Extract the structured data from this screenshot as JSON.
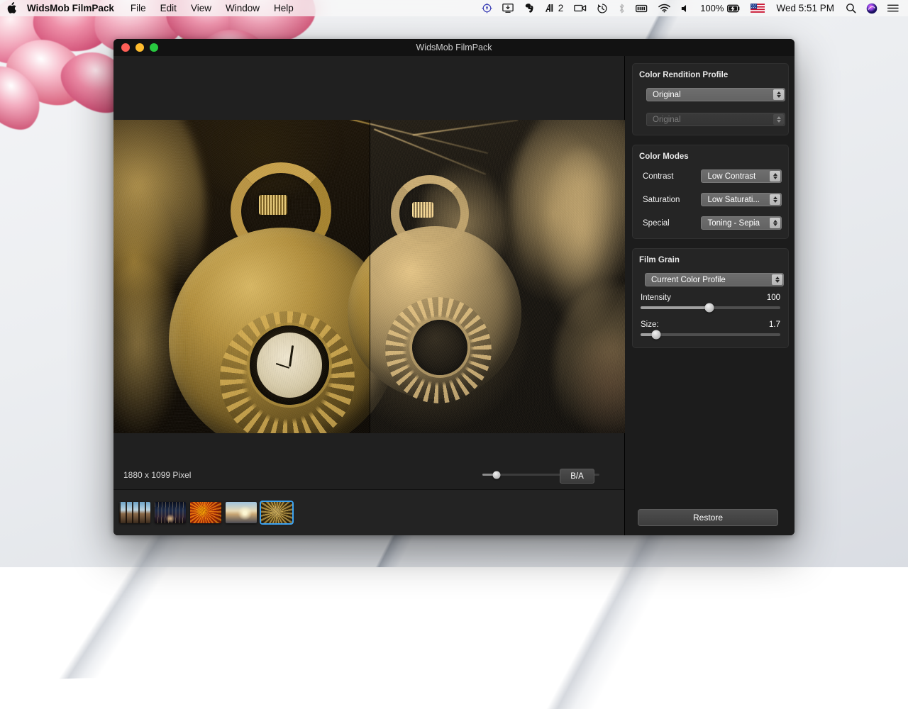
{
  "menubar": {
    "apple_icon": "apple-logo-icon",
    "items": [
      {
        "label": "WidsMob FilmPack",
        "bold": true
      },
      {
        "label": "File"
      },
      {
        "label": "Edit"
      },
      {
        "label": "View"
      },
      {
        "label": "Window"
      },
      {
        "label": "Help"
      }
    ],
    "status": {
      "location_icon": "location-compass-icon",
      "capture_icon": "screen-capture-icon",
      "evernote_icon": "evernote-elephant-icon",
      "alfred_icon": "alfred-a-icon",
      "alfred_badge": "2",
      "screenrecord_icon": "video-camera-icon",
      "timemachine_icon": "time-machine-clock-icon",
      "bluetooth_icon": "bluetooth-icon",
      "battery_bar_icon": "battery-level-icon",
      "wifi_icon": "wifi-icon",
      "volume_icon": "volume-speaker-icon",
      "battery_percent": "100%",
      "battery_charging_icon": "battery-charging-icon",
      "flag_icon": "us-flag-icon",
      "clock": "Wed 5:51 PM",
      "search_icon": "spotlight-search-icon",
      "siri_icon": "siri-icon",
      "controlcenter_icon": "notification-center-icon"
    }
  },
  "window": {
    "title": "WidsMob FilmPack",
    "traffic": {
      "close": "close-button",
      "minimize": "minimize-button",
      "zoom": "maximize-button"
    }
  },
  "preview": {
    "dimensions_label": "1880 x 1099 Pixel",
    "ba_button_label": "B/A",
    "zoom_slider": {
      "value": 12,
      "min": 0,
      "max": 100
    },
    "thumbnails": [
      {
        "name": "thumbnail-1",
        "selected": false
      },
      {
        "name": "thumbnail-2",
        "selected": false
      },
      {
        "name": "thumbnail-3",
        "selected": false
      },
      {
        "name": "thumbnail-4",
        "selected": false
      },
      {
        "name": "thumbnail-5",
        "selected": true
      }
    ]
  },
  "panel": {
    "color_rendition": {
      "title": "Color Rendition Profile",
      "primary": {
        "value": "Original",
        "enabled": true
      },
      "secondary": {
        "value": "Original",
        "enabled": false
      }
    },
    "color_modes": {
      "title": "Color Modes",
      "rows": [
        {
          "label": "Contrast",
          "value": "Low Contrast"
        },
        {
          "label": "Saturation",
          "value": "Low Saturati..."
        },
        {
          "label": "Special",
          "value": "Toning - Sepia"
        }
      ]
    },
    "film_grain": {
      "title": "Film Grain",
      "profile": "Current Color Profile",
      "intensity": {
        "label": "Intensity",
        "value": "100",
        "percent": 49
      },
      "size": {
        "label": "Size:",
        "value": "1.7",
        "percent": 11
      }
    },
    "restore_label": "Restore"
  },
  "colors": {
    "accent_blue": "#3da2f0",
    "panel_bg": "#1c1c1c",
    "group_bg": "#252525",
    "window_bg": "#202020",
    "titlebar_bg": "#121212",
    "traffic_red": "#ff5f57",
    "traffic_yellow": "#febc2e",
    "traffic_green": "#28c840"
  }
}
